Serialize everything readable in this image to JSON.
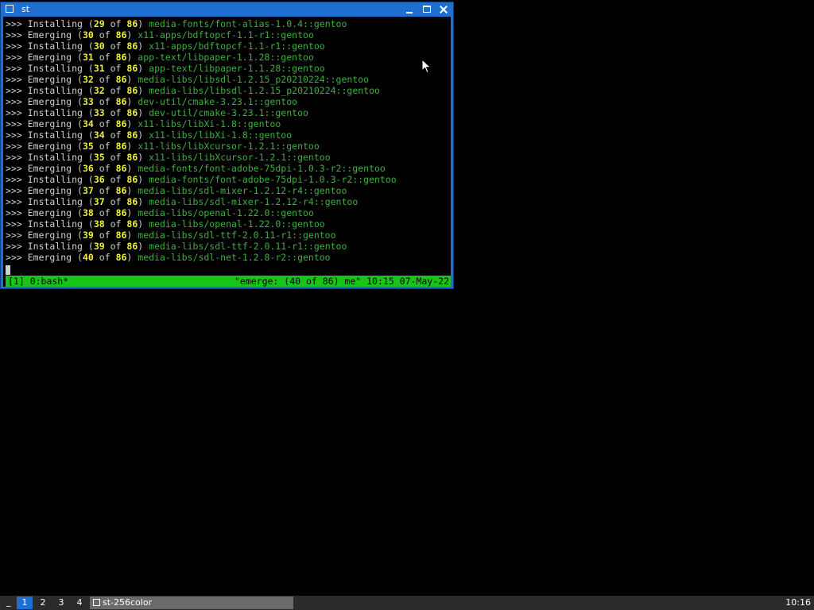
{
  "window": {
    "title": "st"
  },
  "terminal": {
    "lines": [
      {
        "prefix": ">>>",
        "verb": "Installing",
        "num": "29",
        "of": "of",
        "total": "86",
        "pkg": "media-fonts/font-alias-1.0.4::gentoo"
      },
      {
        "prefix": ">>>",
        "verb": "Emerging",
        "num": "30",
        "of": "of",
        "total": "86",
        "pkg": "x11-apps/bdftopcf-1.1-r1::gentoo"
      },
      {
        "prefix": ">>>",
        "verb": "Installing",
        "num": "30",
        "of": "of",
        "total": "86",
        "pkg": "x11-apps/bdftopcf-1.1-r1::gentoo"
      },
      {
        "prefix": ">>>",
        "verb": "Emerging",
        "num": "31",
        "of": "of",
        "total": "86",
        "pkg": "app-text/libpaper-1.1.28::gentoo"
      },
      {
        "prefix": ">>>",
        "verb": "Installing",
        "num": "31",
        "of": "of",
        "total": "86",
        "pkg": "app-text/libpaper-1.1.28::gentoo"
      },
      {
        "prefix": ">>>",
        "verb": "Emerging",
        "num": "32",
        "of": "of",
        "total": "86",
        "pkg": "media-libs/libsdl-1.2.15_p20210224::gentoo"
      },
      {
        "prefix": ">>>",
        "verb": "Installing",
        "num": "32",
        "of": "of",
        "total": "86",
        "pkg": "media-libs/libsdl-1.2.15_p20210224::gentoo"
      },
      {
        "prefix": ">>>",
        "verb": "Emerging",
        "num": "33",
        "of": "of",
        "total": "86",
        "pkg": "dev-util/cmake-3.23.1::gentoo"
      },
      {
        "prefix": ">>>",
        "verb": "Installing",
        "num": "33",
        "of": "of",
        "total": "86",
        "pkg": "dev-util/cmake-3.23.1::gentoo"
      },
      {
        "prefix": ">>>",
        "verb": "Emerging",
        "num": "34",
        "of": "of",
        "total": "86",
        "pkg": "x11-libs/libXi-1.8::gentoo"
      },
      {
        "prefix": ">>>",
        "verb": "Installing",
        "num": "34",
        "of": "of",
        "total": "86",
        "pkg": "x11-libs/libXi-1.8::gentoo"
      },
      {
        "prefix": ">>>",
        "verb": "Emerging",
        "num": "35",
        "of": "of",
        "total": "86",
        "pkg": "x11-libs/libXcursor-1.2.1::gentoo"
      },
      {
        "prefix": ">>>",
        "verb": "Installing",
        "num": "35",
        "of": "of",
        "total": "86",
        "pkg": "x11-libs/libXcursor-1.2.1::gentoo"
      },
      {
        "prefix": ">>>",
        "verb": "Emerging",
        "num": "36",
        "of": "of",
        "total": "86",
        "pkg": "media-fonts/font-adobe-75dpi-1.0.3-r2::gentoo"
      },
      {
        "prefix": ">>>",
        "verb": "Installing",
        "num": "36",
        "of": "of",
        "total": "86",
        "pkg": "media-fonts/font-adobe-75dpi-1.0.3-r2::gentoo"
      },
      {
        "prefix": ">>>",
        "verb": "Emerging",
        "num": "37",
        "of": "of",
        "total": "86",
        "pkg": "media-libs/sdl-mixer-1.2.12-r4::gentoo"
      },
      {
        "prefix": ">>>",
        "verb": "Installing",
        "num": "37",
        "of": "of",
        "total": "86",
        "pkg": "media-libs/sdl-mixer-1.2.12-r4::gentoo"
      },
      {
        "prefix": ">>>",
        "verb": "Emerging",
        "num": "38",
        "of": "of",
        "total": "86",
        "pkg": "media-libs/openal-1.22.0::gentoo"
      },
      {
        "prefix": ">>>",
        "verb": "Installing",
        "num": "38",
        "of": "of",
        "total": "86",
        "pkg": "media-libs/openal-1.22.0::gentoo"
      },
      {
        "prefix": ">>>",
        "verb": "Emerging",
        "num": "39",
        "of": "of",
        "total": "86",
        "pkg": "media-libs/sdl-ttf-2.0.11-r1::gentoo"
      },
      {
        "prefix": ">>>",
        "verb": "Installing",
        "num": "39",
        "of": "of",
        "total": "86",
        "pkg": "media-libs/sdl-ttf-2.0.11-r1::gentoo"
      },
      {
        "prefix": ">>>",
        "verb": "Emerging",
        "num": "40",
        "of": "of",
        "total": "86",
        "pkg": "media-libs/sdl-net-1.2.8-r2::gentoo"
      }
    ],
    "tmux_left": "[1] 0:bash*",
    "tmux_right": "\"emerge: (40 of 86) me\" 10:15 07-May-22"
  },
  "colors": {
    "titlebar": "#1f6fd1",
    "package": "#3fae3f",
    "counter": "#f0f040",
    "tmux_bar": "#19c419",
    "panel": "#2b2b2b"
  },
  "panel": {
    "underscore": "_",
    "workspaces": [
      "1",
      "2",
      "3",
      "4"
    ],
    "active_workspace": "1",
    "task_label": "st-256color",
    "clock": "10:16"
  }
}
